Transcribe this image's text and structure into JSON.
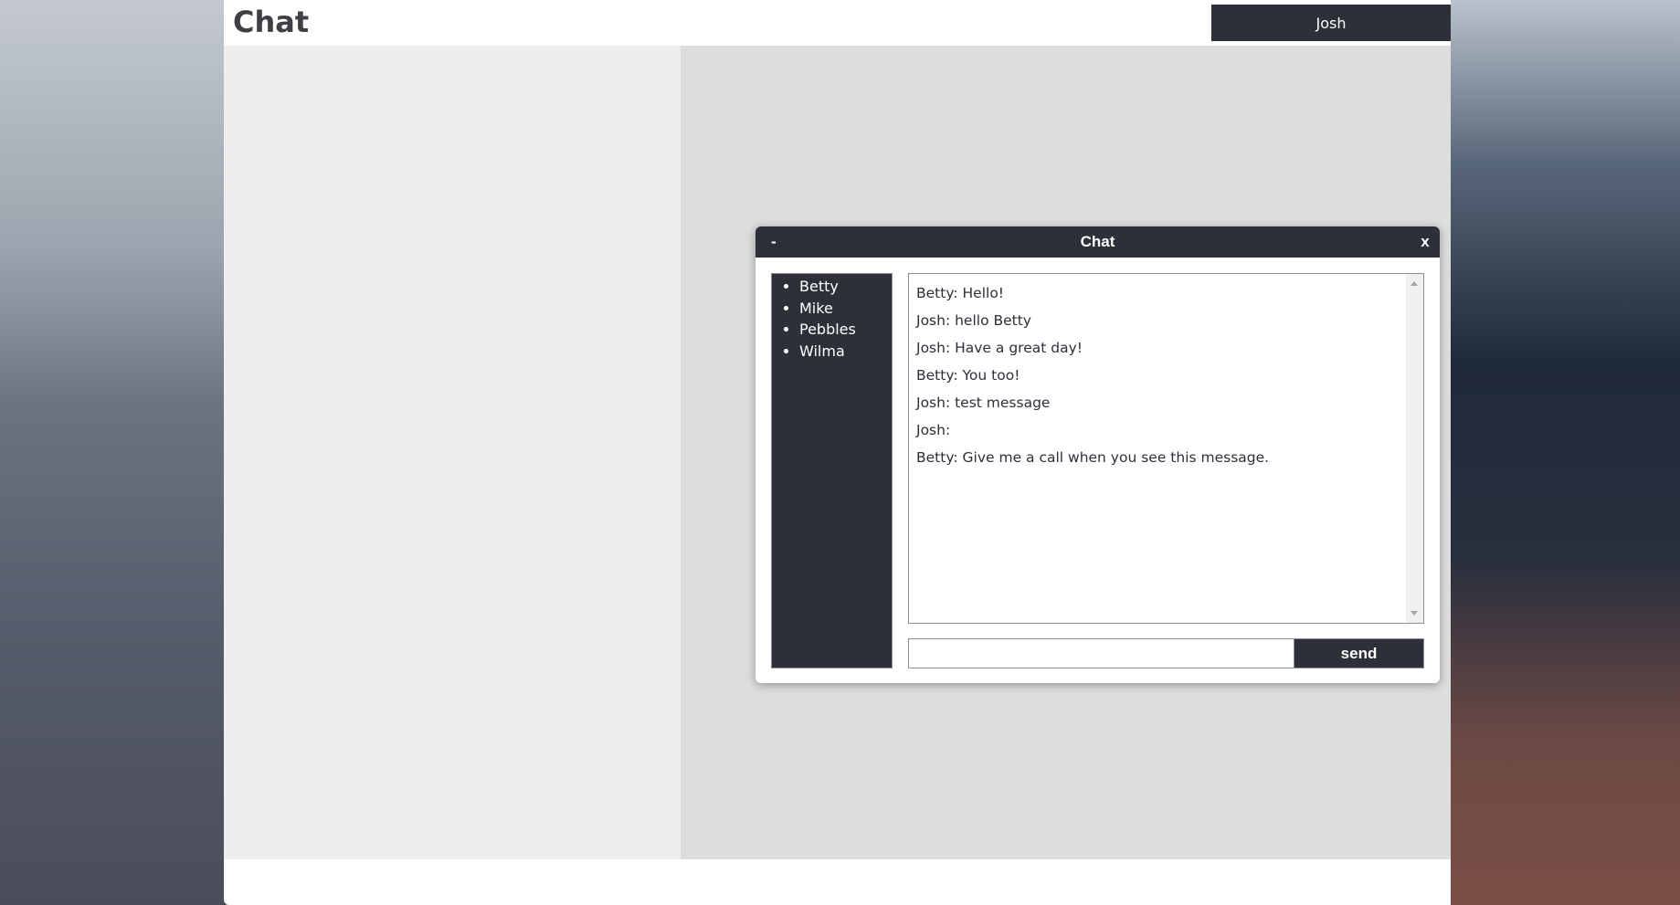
{
  "app": {
    "title": "Chat",
    "current_user": "Josh"
  },
  "chat_window": {
    "title": "Chat",
    "minimize_label": "-",
    "close_label": "x",
    "users": [
      "Betty",
      "Mike",
      "Pebbles",
      "Wilma"
    ],
    "messages": [
      "Betty: Hello!",
      "Josh: hello Betty",
      "Josh: Have a great day!",
      "Betty: You too!",
      "Josh: test message",
      "Josh:",
      "Betty: Give me a call when you see this message."
    ],
    "input": {
      "value": "",
      "placeholder": ""
    },
    "send_label": "send"
  },
  "colors": {
    "dark": "#2d3038",
    "content_left": "#eeeeee",
    "content_right": "#dddddd"
  },
  "icons": {
    "scroll_up": "triangle-up-icon",
    "scroll_down": "triangle-down-icon"
  }
}
